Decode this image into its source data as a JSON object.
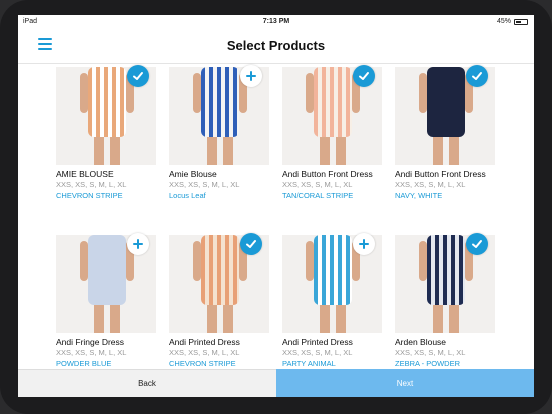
{
  "status_bar": {
    "carrier": "iPad",
    "time": "7:13 PM",
    "battery": "45%",
    "battery_level": 0.45
  },
  "header": {
    "title": "Select Products"
  },
  "products": [
    {
      "name": "AMIE BLOUSE",
      "sizes": "XXS, XS, S, M, L, XL",
      "color": "CHEVRON STRIPE",
      "selected": true,
      "palette": [
        "#e9a87a",
        "#ffffff"
      ]
    },
    {
      "name": "Amie Blouse",
      "sizes": "XXS, XS, S, M, L, XL",
      "color": "Locus Leaf",
      "selected": false,
      "palette": [
        "#2f5fb8",
        "#f4f4f4"
      ]
    },
    {
      "name": "Andi Button Front Dress",
      "sizes": "XXS, XS, S, M, L, XL",
      "color": "TAN/CORAL STRIPE",
      "selected": true,
      "palette": [
        "#f2b49b",
        "#f7efe6"
      ]
    },
    {
      "name": "Andi Button Front Dress",
      "sizes": "XXS, XS, S, M, L, XL",
      "color": "NAVY, WHITE",
      "selected": true,
      "palette": [
        "#1d2540",
        "#1d2540"
      ]
    },
    {
      "name": "Andi Fringe Dress",
      "sizes": "XXS, XS, S, M, L, XL",
      "color": "POWDER BLUE",
      "selected": false,
      "palette": [
        "#c9d5e8",
        "#c9d5e8"
      ]
    },
    {
      "name": "Andi Printed Dress",
      "sizes": "XXS, XS, S, M, L, XL",
      "color": "CHEVRON STRIPE",
      "selected": true,
      "palette": [
        "#e8a076",
        "#f4e2d0"
      ]
    },
    {
      "name": "Andi Printed Dress",
      "sizes": "XXS, XS, S, M, L, XL",
      "color": "PARTY ANIMAL",
      "selected": false,
      "palette": [
        "#3aa6d8",
        "#ffffff"
      ]
    },
    {
      "name": "Arden Blouse",
      "sizes": "XXS, XS, S, M, L, XL",
      "color": "ZEBRA - POWDER",
      "selected": true,
      "palette": [
        "#1f2c52",
        "#e4e8f0"
      ]
    }
  ],
  "footer": {
    "back_label": "Back",
    "next_label": "Next"
  },
  "colors": {
    "accent": "#1a9ad6",
    "next_button": "#6db9ee"
  },
  "icons": {
    "menu": "hamburger-icon",
    "selected": "check-icon",
    "unselected": "plus-icon"
  }
}
